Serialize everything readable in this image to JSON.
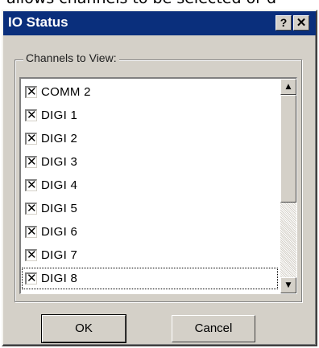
{
  "caption_fragment": "allows channels to be selected or d",
  "window": {
    "title": "IO Status",
    "help_glyph": "?",
    "close_glyph": "✕"
  },
  "group": {
    "label": "Channels to View:"
  },
  "channels": [
    {
      "label": "COMM 2",
      "checked": true,
      "mark": "✕"
    },
    {
      "label": "DIGI 1",
      "checked": true,
      "mark": "✕"
    },
    {
      "label": "DIGI 2",
      "checked": true,
      "mark": "✕"
    },
    {
      "label": "DIGI 3",
      "checked": true,
      "mark": "✕"
    },
    {
      "label": "DIGI 4",
      "checked": true,
      "mark": "✕"
    },
    {
      "label": "DIGI 5",
      "checked": true,
      "mark": "✕"
    },
    {
      "label": "DIGI 6",
      "checked": true,
      "mark": "✕"
    },
    {
      "label": "DIGI 7",
      "checked": true,
      "mark": "✕"
    },
    {
      "label": "DIGI 8",
      "checked": true,
      "mark": "✕"
    }
  ],
  "scrollbar": {
    "up_glyph": "▲",
    "down_glyph": "▼"
  },
  "buttons": {
    "ok": "OK",
    "cancel": "Cancel"
  }
}
